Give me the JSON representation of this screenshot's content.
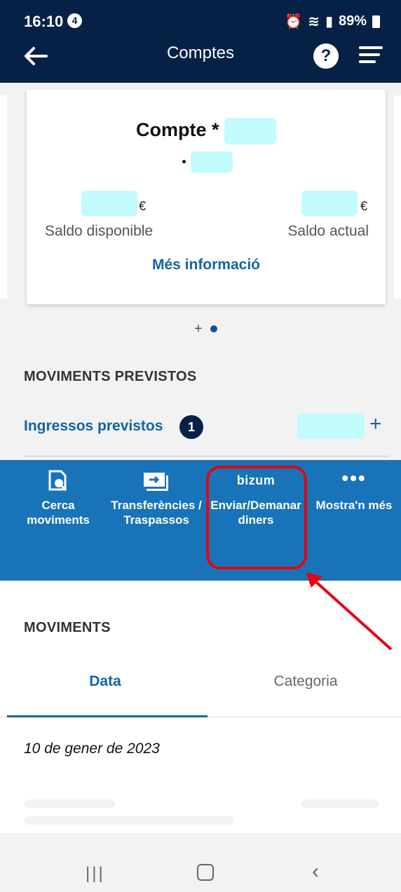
{
  "status_bar": {
    "time": "16:10",
    "notification_count": "4",
    "battery": "89%"
  },
  "header": {
    "title": "Comptes",
    "help_label": "?"
  },
  "account_card": {
    "title": "Compte *",
    "available_currency": "€",
    "available_label": "Saldo disponible",
    "current_currency": "€",
    "current_label": "Saldo actual",
    "more_info_label": "Més informació"
  },
  "pager": {
    "add_label": "+"
  },
  "planned_movements": {
    "section_title": "MOVIMENTS PREVISTOS",
    "income_label": "Ingressos previstos",
    "income_count": "1",
    "add_label": "+"
  },
  "actions": [
    {
      "label": "Cerca moviments",
      "icon": "search-movements-icon"
    },
    {
      "label": "Transferències / Traspassos",
      "icon": "transfer-icon"
    },
    {
      "label": "Enviar/Demanar diners",
      "logo_text": "bizum",
      "icon": "bizum-logo"
    },
    {
      "label": "Mostra'n més",
      "icon": "more-dots-icon"
    }
  ],
  "movements": {
    "section_title": "MOVIMENTS",
    "tabs": [
      "Data",
      "Categoria"
    ],
    "active_tab": "Data",
    "date_header": "10 de gener de 2023"
  },
  "colors": {
    "header_bg": "#072146",
    "action_bar_bg": "#1973b8",
    "link_blue": "#1464a5",
    "highlight_red": "#e20713"
  }
}
